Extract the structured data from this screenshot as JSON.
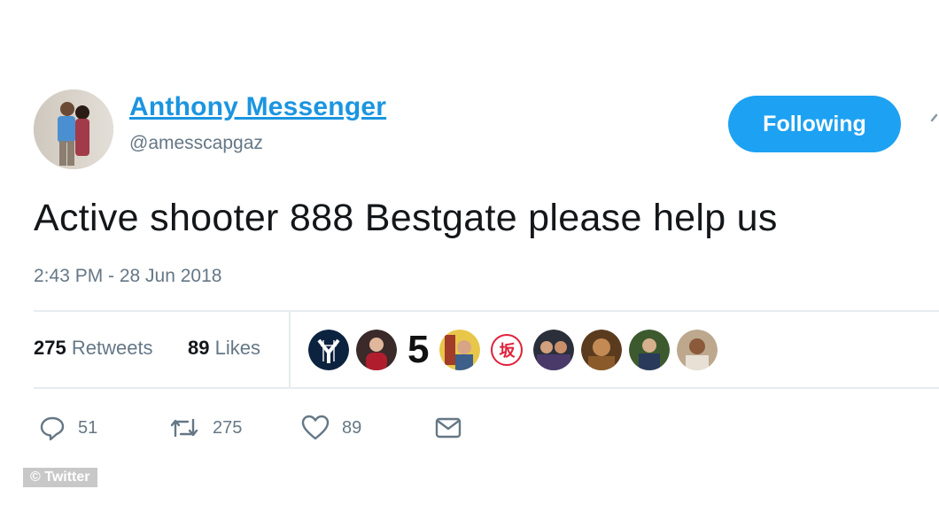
{
  "user": {
    "display_name": "Anthony Messenger",
    "handle": "@amesscapgaz",
    "follow_label": "Following"
  },
  "tweet": {
    "text": "Active shooter 888 Bestgate please help us",
    "timestamp": "2:43 PM - 28 Jun 2018"
  },
  "stats": {
    "retweets_count": "275",
    "retweets_label": "Retweets",
    "likes_count": "89",
    "likes_label": "Likes",
    "liker_badge_number": "5",
    "liker_badge_kanji": "坂"
  },
  "actions": {
    "reply_count": "51",
    "retweet_count": "275",
    "like_count": "89"
  },
  "watermark": "© Twitter",
  "colors": {
    "accent": "#1da1f2",
    "link": "#1b95e0",
    "secondary_text": "#657786",
    "divider": "#e6ecf0"
  },
  "icons": [
    "caret-down-icon",
    "reply-icon",
    "retweet-icon",
    "heart-icon",
    "mail-icon"
  ]
}
